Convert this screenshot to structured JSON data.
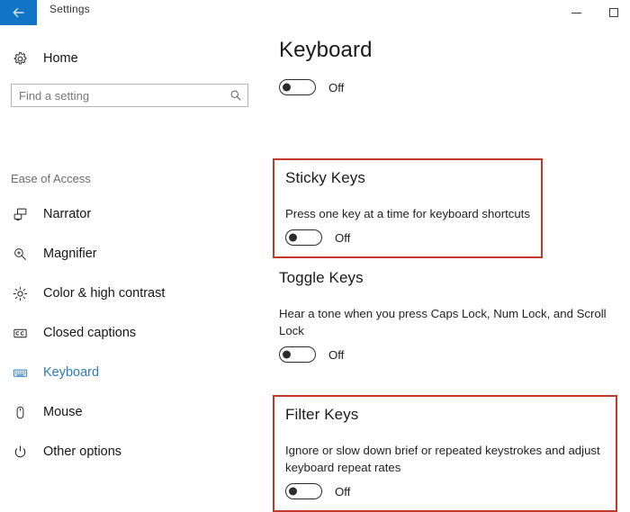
{
  "window": {
    "title": "Settings",
    "back_icon": "back-arrow-icon",
    "controls": {
      "minimize": "minimize-icon",
      "maximize": "maximize-icon"
    },
    "accent_color": "#1274c6"
  },
  "sidebar": {
    "home": {
      "label": "Home",
      "icon": "gear-icon"
    },
    "search": {
      "value": "",
      "placeholder": "Find a setting",
      "icon": "search-icon"
    },
    "group_header": "Ease of Access",
    "items": [
      {
        "label": "Narrator",
        "icon": "narrator-icon",
        "selected": false
      },
      {
        "label": "Magnifier",
        "icon": "magnifier-icon",
        "selected": false
      },
      {
        "label": "Color & high contrast",
        "icon": "brightness-icon",
        "selected": false
      },
      {
        "label": "Closed captions",
        "icon": "closed-captions-icon",
        "selected": false
      },
      {
        "label": "Keyboard",
        "icon": "keyboard-icon",
        "selected": true
      },
      {
        "label": "Mouse",
        "icon": "mouse-icon",
        "selected": false
      },
      {
        "label": "Other options",
        "icon": "power-icon",
        "selected": false
      }
    ],
    "selected_color": "#2a7bc0"
  },
  "main": {
    "page_title": "Keyboard",
    "on_screen_keyboard": {
      "toggle_state": "Off",
      "toggle_on": false
    },
    "sections": [
      {
        "title": "Sticky Keys",
        "description": "Press one key at a time for keyboard shortcuts",
        "toggle_state": "Off",
        "toggle_on": false,
        "highlighted": true
      },
      {
        "title": "Toggle Keys",
        "description": "Hear a tone when you press Caps Lock, Num Lock, and Scroll Lock",
        "toggle_state": "Off",
        "toggle_on": false,
        "highlighted": false
      },
      {
        "title": "Filter Keys",
        "description": "Ignore or slow down brief or repeated keystrokes and adjust keyboard repeat rates",
        "toggle_state": "Off",
        "toggle_on": false,
        "highlighted": true
      }
    ]
  },
  "annotation": {
    "box_color": "#c0392b"
  }
}
